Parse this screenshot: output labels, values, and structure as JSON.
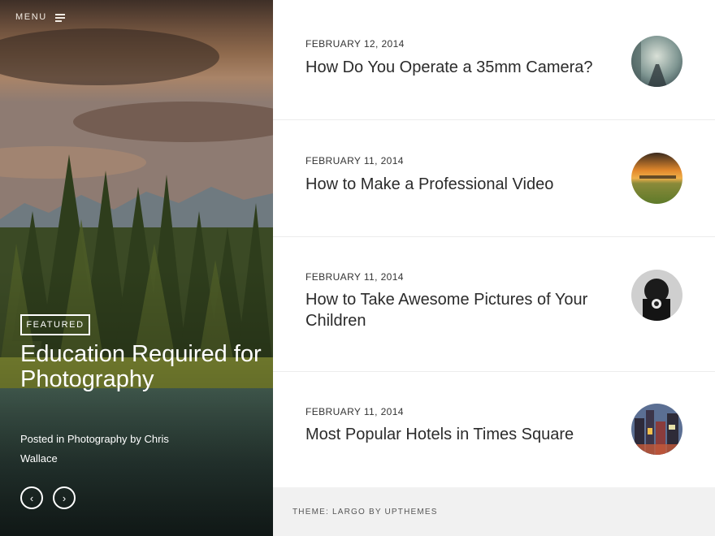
{
  "nav": {
    "menu_label": "MENU"
  },
  "featured": {
    "badge": "FEATURED",
    "title": "Education Required for Photography",
    "meta_prefix": "Posted in ",
    "category": "Photography",
    "meta_by": " by ",
    "author": "Chris Wallace",
    "prev_symbol": "‹",
    "next_symbol": "›"
  },
  "posts": [
    {
      "date": "FEBRUARY 12, 2014",
      "title": "How Do You Operate a 35mm Camera?"
    },
    {
      "date": "FEBRUARY 11, 2014",
      "title": "How to Make a Professional Video"
    },
    {
      "date": "FEBRUARY 11, 2014",
      "title": "How to Take Awesome Pictures of Your Children"
    },
    {
      "date": "FEBRUARY 11, 2014",
      "title": "Most Popular Hotels in Times Square"
    }
  ],
  "footer": {
    "text": "THEME: LARGO BY UPTHEMES"
  },
  "colors": {
    "footer_bg": "#f1f1f1",
    "text_dark": "#2b2b2b"
  }
}
